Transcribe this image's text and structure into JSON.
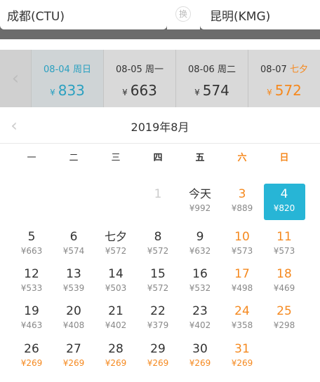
{
  "route": {
    "from": "成都(CTU)",
    "to": "昆明(KMG)",
    "swap_label": "换"
  },
  "strip": {
    "prev_icon": "chevron-left-icon",
    "cells": [
      {
        "date": "08-04",
        "week": "周日",
        "price": "833",
        "state": "selected"
      },
      {
        "date": "08-05",
        "week": "周一",
        "price": "663",
        "state": "normal"
      },
      {
        "date": "08-06",
        "week": "周二",
        "price": "574",
        "state": "normal"
      },
      {
        "date": "08-07",
        "week": "七夕",
        "price": "572",
        "state": "festival"
      }
    ],
    "currency": "¥"
  },
  "calendar": {
    "title": "2019年8月",
    "weekdays": [
      "一",
      "二",
      "三",
      "四",
      "五",
      "六",
      "日"
    ],
    "days": [
      {
        "label": "1",
        "price": "",
        "col": 3,
        "row": 0
      },
      {
        "label": "今天",
        "price": "¥992",
        "col": 4,
        "row": 0
      },
      {
        "label": "3",
        "price": "¥889",
        "col": 5,
        "row": 0
      },
      {
        "label": "4",
        "price": "¥820",
        "col": 6,
        "row": 0
      },
      {
        "label": "5",
        "price": "¥663",
        "col": 0,
        "row": 1
      },
      {
        "label": "6",
        "price": "¥574",
        "col": 1,
        "row": 1
      },
      {
        "label": "七夕",
        "price": "¥572",
        "col": 2,
        "row": 1
      },
      {
        "label": "8",
        "price": "¥572",
        "col": 3,
        "row": 1
      },
      {
        "label": "9",
        "price": "¥632",
        "col": 4,
        "row": 1
      },
      {
        "label": "10",
        "price": "¥573",
        "col": 5,
        "row": 1
      },
      {
        "label": "11",
        "price": "¥573",
        "col": 6,
        "row": 1
      },
      {
        "label": "12",
        "price": "¥533",
        "col": 0,
        "row": 2
      },
      {
        "label": "13",
        "price": "¥539",
        "col": 1,
        "row": 2
      },
      {
        "label": "14",
        "price": "¥503",
        "col": 2,
        "row": 2
      },
      {
        "label": "15",
        "price": "¥572",
        "col": 3,
        "row": 2
      },
      {
        "label": "16",
        "price": "¥532",
        "col": 4,
        "row": 2
      },
      {
        "label": "17",
        "price": "¥498",
        "col": 5,
        "row": 2
      },
      {
        "label": "18",
        "price": "¥469",
        "col": 6,
        "row": 2
      },
      {
        "label": "19",
        "price": "¥463",
        "col": 0,
        "row": 3
      },
      {
        "label": "20",
        "price": "¥408",
        "col": 1,
        "row": 3
      },
      {
        "label": "21",
        "price": "¥402",
        "col": 2,
        "row": 3
      },
      {
        "label": "22",
        "price": "¥379",
        "col": 3,
        "row": 3
      },
      {
        "label": "23",
        "price": "¥402",
        "col": 4,
        "row": 3
      },
      {
        "label": "24",
        "price": "¥358",
        "col": 5,
        "row": 3
      },
      {
        "label": "25",
        "price": "¥298",
        "col": 6,
        "row": 3
      },
      {
        "label": "26",
        "price": "¥269",
        "col": 0,
        "row": 4
      },
      {
        "label": "27",
        "price": "¥269",
        "col": 1,
        "row": 4
      },
      {
        "label": "28",
        "price": "¥269",
        "col": 2,
        "row": 4
      },
      {
        "label": "29",
        "price": "¥269",
        "col": 3,
        "row": 4
      },
      {
        "label": "30",
        "price": "¥269",
        "col": 4,
        "row": 4
      },
      {
        "label": "31",
        "price": "¥269",
        "col": 5,
        "row": 4
      }
    ]
  },
  "colors": {
    "accent": "#27b5d6",
    "weekend": "#f5891f",
    "selected_text": "#2aa0c0"
  }
}
